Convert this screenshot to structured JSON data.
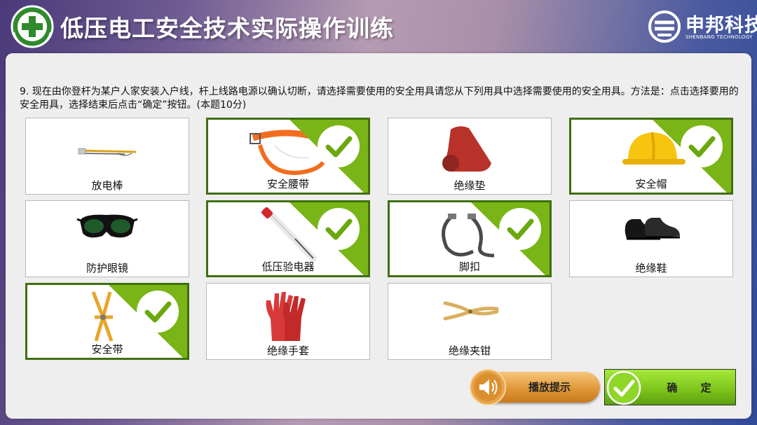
{
  "app": {
    "title": "低压电工安全技术实际操作训练",
    "brand_name": "申邦科技",
    "brand_sub": "SHENBANG TECHNOLOGY"
  },
  "question": {
    "text": "9. 现在由你登杆为某户人家安装入户线，杆上线路电源以确认切断，请选择需要使用的安全用具请您从下列用具中选择需要使用的安全用具。方法是：点击选择要用的安全用具，选择结束后点击“确定”按钮。(本题10分)"
  },
  "items": [
    {
      "label": "放电棒",
      "selected": false,
      "icon": "discharge-rod-icon"
    },
    {
      "label": "安全腰带",
      "selected": true,
      "icon": "safety-belt-icon"
    },
    {
      "label": "绝缘垫",
      "selected": false,
      "icon": "insulating-mat-icon"
    },
    {
      "label": "安全帽",
      "selected": true,
      "icon": "hard-hat-icon"
    },
    {
      "label": "防护眼镜",
      "selected": false,
      "icon": "goggles-icon"
    },
    {
      "label": "低压验电器",
      "selected": true,
      "icon": "voltage-tester-icon"
    },
    {
      "label": "脚扣",
      "selected": true,
      "icon": "climbing-spikes-icon"
    },
    {
      "label": "绝缘鞋",
      "selected": false,
      "icon": "insulating-shoes-icon"
    },
    {
      "label": "安全带",
      "selected": true,
      "icon": "safety-harness-icon"
    },
    {
      "label": "绝缘手套",
      "selected": false,
      "icon": "insulating-gloves-icon"
    },
    {
      "label": "绝缘夹钳",
      "selected": false,
      "icon": "insulating-pliers-icon"
    }
  ],
  "buttons": {
    "hint": "播放提示",
    "confirm": "确 定"
  },
  "colors": {
    "selected_border": "#3f6f10",
    "selected_corner": "#79b517",
    "check_mark": "#6aa80e",
    "hint_button": "#e09838",
    "confirm_button": "#7cc21a"
  }
}
